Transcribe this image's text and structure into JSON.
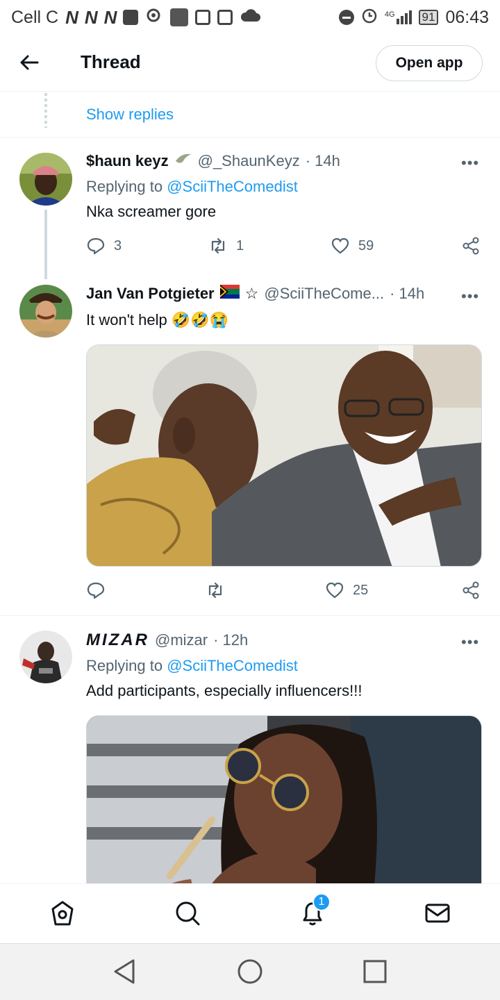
{
  "status_bar": {
    "carrier": "Cell C",
    "n_icons": [
      "N",
      "N",
      "N"
    ],
    "network": "4G",
    "battery": "91",
    "time": "06:43"
  },
  "header": {
    "title": "Thread",
    "open_app_label": "Open app"
  },
  "show_replies": "Show replies",
  "tweets": [
    {
      "display_name": "$haun keyz",
      "handle": "@_ShaunKeyz",
      "time": "· 14h",
      "more": "•••",
      "replying_prefix": "Replying to",
      "replying_to": "@SciiTheComedist",
      "text": "Nka screamer gore",
      "replies": "3",
      "retweets": "1",
      "likes": "59"
    },
    {
      "display_name": "Jan Van Potgieter",
      "badges": "☆",
      "handle": "@SciiTheCome...",
      "time": "· 14h",
      "more": "•••",
      "text": "It won't help 🤣🤣😭",
      "replies": "",
      "retweets": "",
      "likes": "25"
    },
    {
      "display_name": "MIZAR",
      "handle": "@mizar",
      "time": "· 12h",
      "more": "•••",
      "replying_prefix": "Replying to",
      "replying_to": "@SciiTheComedist",
      "text": "Add participants, especially influencers!!!"
    }
  ],
  "bottom_nav": {
    "notification_badge": "1",
    "items": [
      "home-icon",
      "search-icon",
      "bell-icon",
      "mail-icon"
    ]
  },
  "colors": {
    "accent": "#1d9bf0",
    "text": "#0f1419",
    "muted": "#536471",
    "border": "#cfd9de"
  }
}
